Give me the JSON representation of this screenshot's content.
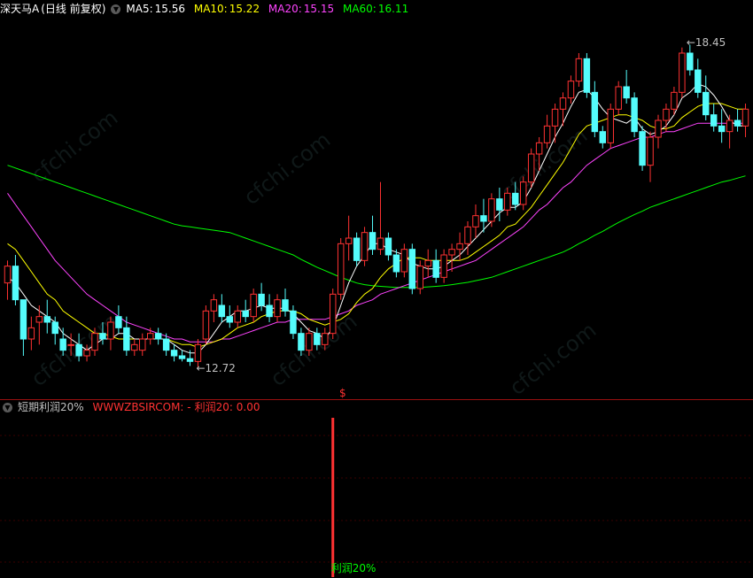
{
  "main": {
    "stock_name": "深天马A",
    "period_label": "(日线 前复权)",
    "collapse_icon": "chevron-down-icon",
    "ma": [
      {
        "label": "MA5:",
        "value": "15.56",
        "color": "#ffffff"
      },
      {
        "label": "MA10:",
        "value": "15.22",
        "color": "#ffff00"
      },
      {
        "label": "MA20:",
        "value": "15.15",
        "color": "#ff44ff"
      },
      {
        "label": "MA60:",
        "value": "16.11",
        "color": "#00ff00"
      }
    ],
    "high_label": "18.45",
    "low_label": "12.72",
    "signal_marker": "$",
    "watermark": "cfchi.com"
  },
  "indicator": {
    "name": "短期利润20%",
    "formula_text": "WWWZBSIRCOM: -",
    "value_label": "利润20: 0.00",
    "bar_label": "利润20%"
  },
  "colors": {
    "up": "#ff3232",
    "down": "#54fcfc",
    "background": "#000000",
    "divider": "#9a1010"
  },
  "chart_data": {
    "type": "candlestick",
    "ohlc": [
      [
        14.2,
        14.6,
        13.9,
        14.5
      ],
      [
        14.5,
        14.7,
        13.8,
        13.9
      ],
      [
        13.9,
        13.9,
        12.9,
        13.2
      ],
      [
        13.2,
        13.6,
        13.0,
        13.4
      ],
      [
        13.5,
        13.8,
        13.1,
        13.6
      ],
      [
        13.6,
        13.9,
        13.3,
        13.5
      ],
      [
        13.5,
        13.6,
        13.1,
        13.3
      ],
      [
        13.2,
        13.4,
        12.9,
        13.0
      ],
      [
        13.1,
        13.3,
        12.9,
        13.1
      ],
      [
        13.1,
        13.3,
        12.8,
        12.9
      ],
      [
        12.9,
        13.1,
        12.8,
        13.0
      ],
      [
        13.0,
        13.4,
        12.9,
        13.3
      ],
      [
        13.3,
        13.5,
        13.1,
        13.2
      ],
      [
        13.2,
        13.6,
        13.0,
        13.5
      ],
      [
        13.6,
        13.8,
        13.3,
        13.4
      ],
      [
        13.4,
        13.6,
        12.9,
        13.0
      ],
      [
        13.0,
        13.2,
        12.9,
        13.1
      ],
      [
        13.0,
        13.3,
        12.9,
        13.2
      ],
      [
        13.2,
        13.4,
        13.1,
        13.3
      ],
      [
        13.3,
        13.4,
        13.1,
        13.2
      ],
      [
        13.2,
        13.3,
        12.9,
        13.0
      ],
      [
        13.0,
        13.1,
        12.8,
        12.9
      ],
      [
        12.9,
        13.0,
        12.8,
        12.85
      ],
      [
        12.85,
        13.0,
        12.72,
        12.8
      ],
      [
        12.8,
        13.2,
        12.7,
        13.1
      ],
      [
        13.2,
        13.8,
        13.1,
        13.7
      ],
      [
        13.7,
        14.0,
        13.5,
        13.9
      ],
      [
        13.8,
        14.0,
        13.5,
        13.6
      ],
      [
        13.6,
        13.8,
        13.4,
        13.5
      ],
      [
        13.5,
        13.8,
        13.4,
        13.7
      ],
      [
        13.7,
        13.9,
        13.5,
        13.6
      ],
      [
        13.6,
        14.1,
        13.5,
        14.0
      ],
      [
        14.0,
        14.2,
        13.7,
        13.8
      ],
      [
        13.8,
        14.0,
        13.5,
        13.6
      ],
      [
        13.6,
        14.0,
        13.5,
        13.9
      ],
      [
        13.9,
        14.1,
        13.6,
        13.7
      ],
      [
        13.7,
        13.8,
        13.2,
        13.3
      ],
      [
        13.3,
        13.4,
        12.9,
        13.0
      ],
      [
        13.0,
        13.4,
        12.9,
        13.3
      ],
      [
        13.3,
        13.4,
        13.0,
        13.1
      ],
      [
        13.1,
        13.4,
        13.0,
        13.3
      ],
      [
        13.3,
        14.1,
        13.2,
        14.0
      ],
      [
        14.0,
        15.0,
        13.9,
        14.9
      ],
      [
        14.9,
        15.4,
        14.6,
        15.0
      ],
      [
        15.0,
        15.1,
        14.5,
        14.6
      ],
      [
        14.6,
        15.2,
        14.5,
        15.1
      ],
      [
        15.1,
        15.4,
        14.7,
        14.8
      ],
      [
        14.8,
        16.0,
        14.7,
        15.0
      ],
      [
        15.0,
        15.1,
        14.6,
        14.7
      ],
      [
        14.7,
        14.8,
        14.3,
        14.4
      ],
      [
        14.4,
        14.9,
        14.3,
        14.8
      ],
      [
        14.8,
        14.9,
        14.0,
        14.1
      ],
      [
        14.1,
        14.6,
        14.0,
        14.5
      ],
      [
        14.5,
        14.8,
        14.3,
        14.6
      ],
      [
        14.6,
        14.8,
        14.2,
        14.3
      ],
      [
        14.3,
        14.8,
        14.2,
        14.7
      ],
      [
        14.7,
        14.9,
        14.4,
        14.8
      ],
      [
        14.8,
        15.1,
        14.6,
        14.9
      ],
      [
        14.9,
        15.3,
        14.7,
        15.2
      ],
      [
        15.2,
        15.6,
        15.0,
        15.4
      ],
      [
        15.4,
        15.7,
        15.1,
        15.3
      ],
      [
        15.3,
        15.8,
        15.2,
        15.7
      ],
      [
        15.7,
        15.9,
        15.3,
        15.5
      ],
      [
        15.5,
        15.9,
        15.4,
        15.8
      ],
      [
        15.8,
        16.0,
        15.5,
        15.6
      ],
      [
        15.6,
        16.1,
        15.5,
        16.0
      ],
      [
        16.0,
        16.6,
        15.9,
        16.5
      ],
      [
        16.5,
        16.8,
        16.2,
        16.7
      ],
      [
        16.7,
        17.2,
        16.6,
        17.0
      ],
      [
        17.0,
        17.4,
        16.7,
        17.3
      ],
      [
        17.3,
        17.6,
        17.0,
        17.5
      ],
      [
        17.5,
        17.9,
        17.4,
        17.8
      ],
      [
        17.8,
        18.3,
        17.7,
        18.2
      ],
      [
        18.2,
        18.3,
        17.5,
        17.6
      ],
      [
        17.6,
        17.8,
        16.8,
        16.9
      ],
      [
        16.9,
        17.0,
        16.6,
        16.7
      ],
      [
        16.7,
        17.4,
        16.6,
        17.3
      ],
      [
        17.3,
        17.8,
        17.2,
        17.7
      ],
      [
        17.7,
        18.0,
        17.4,
        17.5
      ],
      [
        17.5,
        17.6,
        16.8,
        16.9
      ],
      [
        16.9,
        17.0,
        16.2,
        16.3
      ],
      [
        16.3,
        16.9,
        16.0,
        16.8
      ],
      [
        16.8,
        17.2,
        16.6,
        17.1
      ],
      [
        17.1,
        17.4,
        16.9,
        17.3
      ],
      [
        17.3,
        17.7,
        17.2,
        17.6
      ],
      [
        17.6,
        18.4,
        17.5,
        18.3
      ],
      [
        18.3,
        18.45,
        17.9,
        18.0
      ],
      [
        18.0,
        18.2,
        17.5,
        17.6
      ],
      [
        17.6,
        17.9,
        17.1,
        17.2
      ],
      [
        17.2,
        17.4,
        16.9,
        17.0
      ],
      [
        17.0,
        17.3,
        16.7,
        16.9
      ],
      [
        16.9,
        17.2,
        16.6,
        17.1
      ],
      [
        17.1,
        17.3,
        16.9,
        17.0
      ],
      [
        17.0,
        17.4,
        16.8,
        17.3
      ]
    ],
    "ma5": [
      14.3,
      14.2,
      14.0,
      13.8,
      13.7,
      13.6,
      13.5,
      13.3,
      13.2,
      13.1,
      13.0,
      13.1,
      13.2,
      13.2,
      13.3,
      13.3,
      13.2,
      13.2,
      13.2,
      13.2,
      13.2,
      13.1,
      13.0,
      12.95,
      12.95,
      13.1,
      13.3,
      13.5,
      13.6,
      13.7,
      13.7,
      13.75,
      13.8,
      13.75,
      13.75,
      13.75,
      13.65,
      13.5,
      13.35,
      13.3,
      13.2,
      13.4,
      13.8,
      14.2,
      14.5,
      14.7,
      14.9,
      14.9,
      14.8,
      14.75,
      14.7,
      14.55,
      14.5,
      14.45,
      14.45,
      14.5,
      14.6,
      14.7,
      14.85,
      15.0,
      15.15,
      15.3,
      15.45,
      15.55,
      15.55,
      15.65,
      15.9,
      16.2,
      16.5,
      16.8,
      17.05,
      17.35,
      17.6,
      17.65,
      17.5,
      17.3,
      17.15,
      17.1,
      17.05,
      17.15,
      16.95,
      16.85,
      16.9,
      17.0,
      17.2,
      17.5,
      17.6,
      17.75,
      17.7,
      17.55,
      17.35,
      17.1,
      17.0,
      17.0
    ],
    "ma10": [
      14.9,
      14.8,
      14.6,
      14.4,
      14.2,
      14.0,
      13.9,
      13.7,
      13.6,
      13.5,
      13.4,
      13.3,
      13.3,
      13.25,
      13.2,
      13.2,
      13.2,
      13.2,
      13.2,
      13.2,
      13.2,
      13.15,
      13.1,
      13.1,
      13.05,
      13.1,
      13.15,
      13.2,
      13.3,
      13.4,
      13.45,
      13.5,
      13.6,
      13.65,
      13.7,
      13.7,
      13.7,
      13.65,
      13.55,
      13.5,
      13.45,
      13.5,
      13.55,
      13.65,
      13.85,
      14.0,
      14.1,
      14.3,
      14.45,
      14.55,
      14.65,
      14.65,
      14.65,
      14.6,
      14.6,
      14.6,
      14.6,
      14.6,
      14.65,
      14.75,
      14.85,
      14.95,
      15.05,
      15.2,
      15.25,
      15.4,
      15.55,
      15.75,
      15.95,
      16.15,
      16.35,
      16.6,
      16.85,
      17.0,
      17.05,
      17.1,
      17.15,
      17.2,
      17.2,
      17.15,
      17.1,
      17.0,
      16.95,
      16.95,
      17.0,
      17.15,
      17.25,
      17.35,
      17.4,
      17.4,
      17.4,
      17.35,
      17.3,
      17.3
    ],
    "ma20": [
      15.8,
      15.6,
      15.4,
      15.2,
      15.0,
      14.8,
      14.6,
      14.45,
      14.3,
      14.15,
      14.0,
      13.9,
      13.8,
      13.7,
      13.6,
      13.5,
      13.45,
      13.4,
      13.35,
      13.3,
      13.25,
      13.2,
      13.2,
      13.15,
      13.15,
      13.15,
      13.15,
      13.2,
      13.2,
      13.25,
      13.3,
      13.35,
      13.4,
      13.45,
      13.5,
      13.5,
      13.55,
      13.55,
      13.55,
      13.55,
      13.55,
      13.6,
      13.65,
      13.7,
      13.8,
      13.85,
      13.9,
      14.0,
      14.05,
      14.1,
      14.15,
      14.2,
      14.25,
      14.3,
      14.35,
      14.4,
      14.45,
      14.5,
      14.55,
      14.6,
      14.7,
      14.8,
      14.9,
      15.0,
      15.1,
      15.2,
      15.35,
      15.5,
      15.6,
      15.75,
      15.9,
      16.0,
      16.15,
      16.3,
      16.4,
      16.5,
      16.6,
      16.65,
      16.7,
      16.75,
      16.8,
      16.8,
      16.85,
      16.9,
      16.9,
      16.95,
      17.0,
      17.05,
      17.05,
      17.05,
      17.05,
      17.05,
      17.05,
      17.05
    ],
    "ma60": [
      16.3,
      16.25,
      16.2,
      16.15,
      16.1,
      16.05,
      16.0,
      15.95,
      15.9,
      15.85,
      15.8,
      15.75,
      15.7,
      15.65,
      15.6,
      15.55,
      15.5,
      15.45,
      15.4,
      15.35,
      15.3,
      15.25,
      15.22,
      15.2,
      15.18,
      15.16,
      15.14,
      15.12,
      15.1,
      15.05,
      15.0,
      14.95,
      14.9,
      14.85,
      14.8,
      14.75,
      14.7,
      14.62,
      14.55,
      14.48,
      14.42,
      14.36,
      14.3,
      14.25,
      14.2,
      14.17,
      14.15,
      14.14,
      14.13,
      14.12,
      14.12,
      14.12,
      14.12,
      14.13,
      14.14,
      14.15,
      14.17,
      14.19,
      14.21,
      14.24,
      14.27,
      14.3,
      14.35,
      14.4,
      14.45,
      14.5,
      14.55,
      14.6,
      14.65,
      14.7,
      14.75,
      14.82,
      14.9,
      14.97,
      15.05,
      15.12,
      15.2,
      15.28,
      15.35,
      15.42,
      15.48,
      15.55,
      15.6,
      15.65,
      15.7,
      15.75,
      15.8,
      15.85,
      15.9,
      15.95,
      16.0,
      16.03,
      16.07,
      16.11
    ],
    "indicator_signal_index": 41,
    "indicator_values": {
      "index": 41,
      "value": 1
    }
  }
}
